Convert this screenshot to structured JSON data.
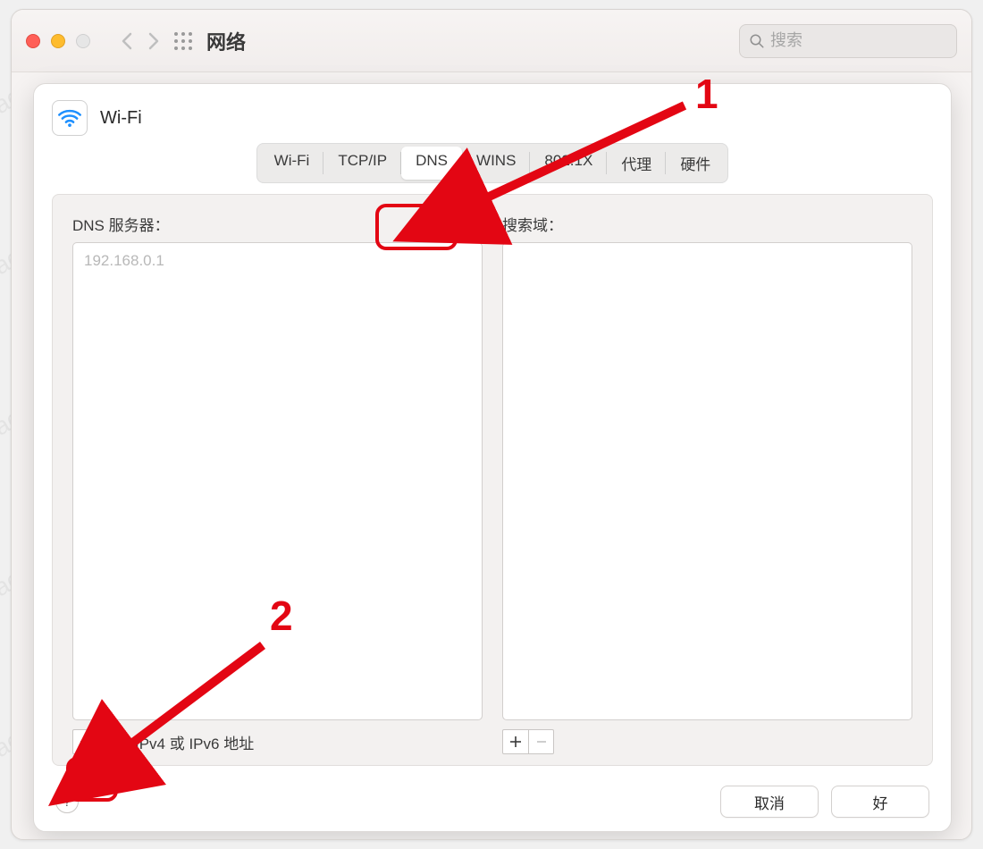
{
  "watermark": "macOShome.com",
  "window": {
    "title": "网络",
    "search_placeholder": "搜索"
  },
  "sheet": {
    "connection_name": "Wi-Fi",
    "tabs": [
      "Wi-Fi",
      "TCP/IP",
      "DNS",
      "WINS",
      "802.1X",
      "代理",
      "硬件"
    ],
    "active_tab_index": 2,
    "dns": {
      "left_label": "DNS 服务器：",
      "right_label": "搜索域：",
      "servers": [
        "192.168.0.1"
      ],
      "add_hint": "IPv4 或 IPv6 地址"
    },
    "buttons": {
      "cancel": "取消",
      "ok": "好"
    }
  },
  "annotations": {
    "label1": "1",
    "label2": "2"
  }
}
